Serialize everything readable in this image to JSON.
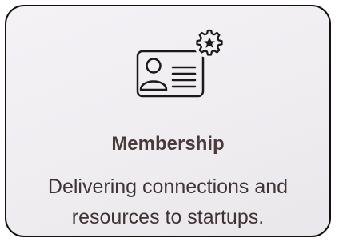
{
  "card": {
    "icon": "member-card-with-gear-icon",
    "title": "Membership",
    "description_line1": "Delivering connections and",
    "description_line2": "resources to startups."
  },
  "colors": {
    "border": "#111111",
    "background": "#efedf0",
    "title": "#4a3a3c",
    "text": "#3f3335",
    "icon_stroke": "#1a1a1a"
  }
}
